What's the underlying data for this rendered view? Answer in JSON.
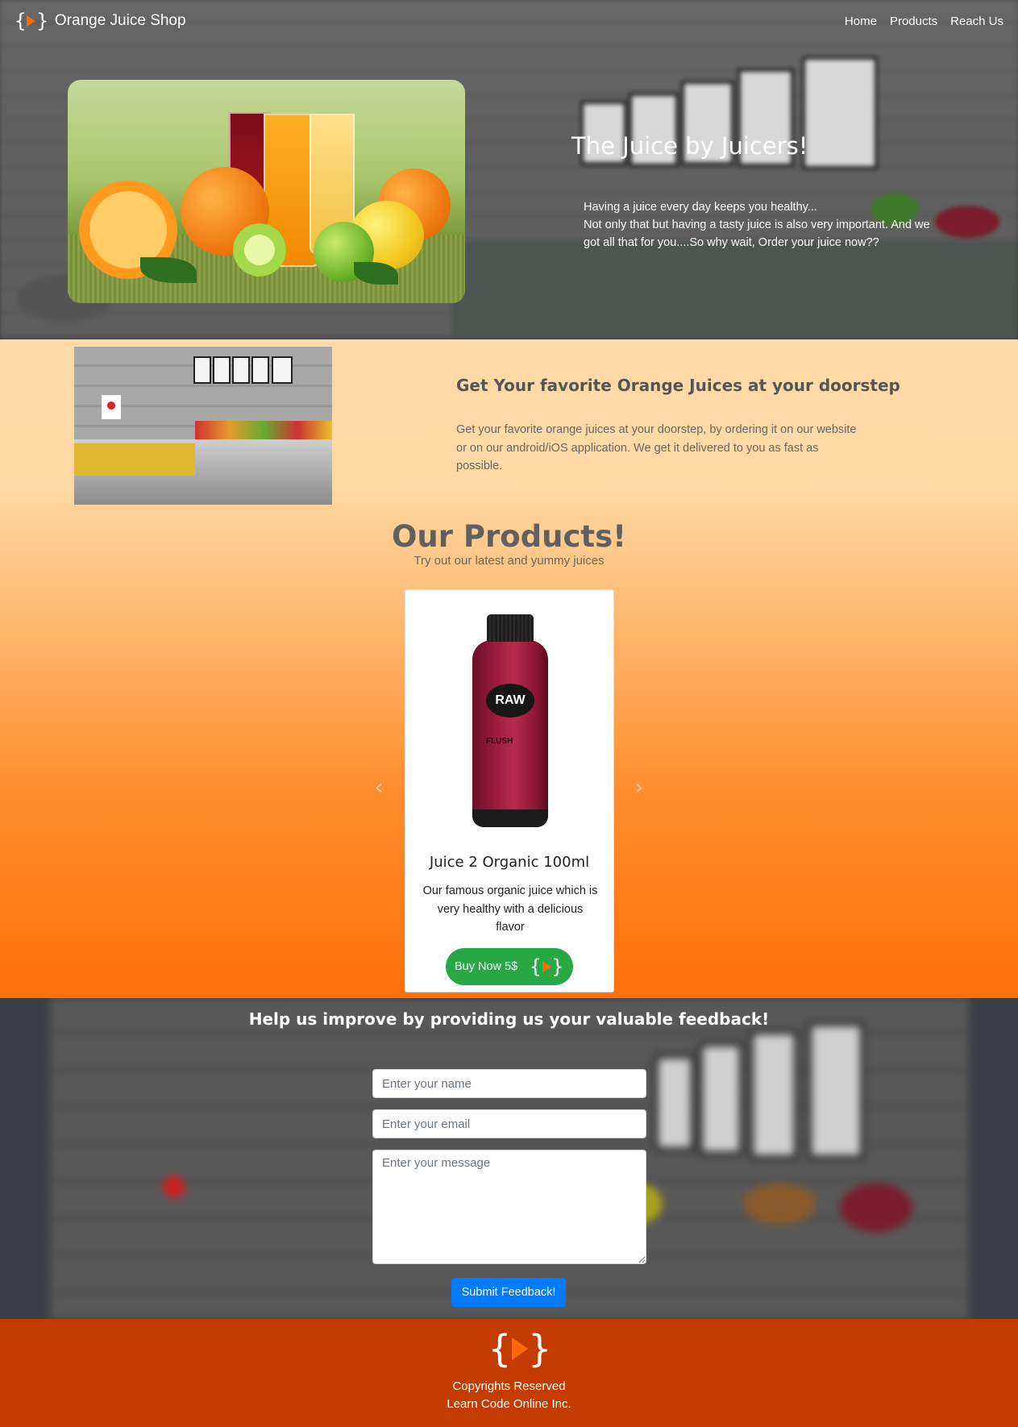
{
  "nav": {
    "brand": "Orange Juice Shop",
    "links": [
      "Home",
      "Products",
      "Reach Us"
    ]
  },
  "hero": {
    "title": "The Juice by Juicers!",
    "text_line1": "Having a juice every day keeps you healthy...",
    "text_line2": "Not only that but having a tasty juice is also very important. And we got all that for you....So why wait, Order your juice now??"
  },
  "doorstep": {
    "title": "Get Your favorite Orange Juices at your doorstep",
    "text": "Get your favorite orange juices at your doorstep, by ordering it on our website or on our android/iOS application. We get it delivered to you as fast as possible."
  },
  "products": {
    "title": "Our Products!",
    "subtitle": "Try out our latest and yummy juices",
    "card": {
      "brand_on_bottle": "RAW",
      "flavor_on_bottle": "FLUSH",
      "name": "Juice 2 Organic 100ml",
      "description": "Our famous organic juice which is very healthy with a delicious flavor",
      "button": "Buy Now 5$"
    },
    "prev_icon": "chevron-left-icon",
    "next_icon": "chevron-right-icon"
  },
  "feedback": {
    "title": "Help us improve by providing us your valuable feedback!",
    "name_placeholder": "Enter your name",
    "email_placeholder": "Enter your email",
    "message_placeholder": "Enter your message",
    "submit": "Submit Feedback!"
  },
  "footer": {
    "line1": "Copyrights Reserved",
    "line2": "Learn Code Online Inc."
  },
  "colors": {
    "accent": "#ff6a00",
    "buy_button": "#28a745",
    "submit_button": "#007bff",
    "footer": "#c43b00"
  }
}
